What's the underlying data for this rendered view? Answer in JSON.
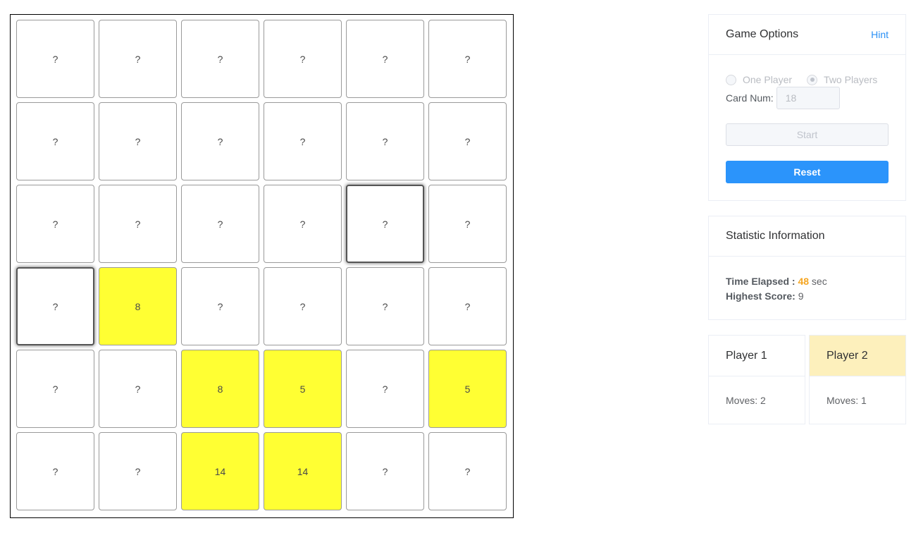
{
  "board": {
    "columns": 6,
    "rows": 6,
    "cards": [
      {
        "label": "?",
        "state": "hidden"
      },
      {
        "label": "?",
        "state": "hidden"
      },
      {
        "label": "?",
        "state": "hidden"
      },
      {
        "label": "?",
        "state": "hidden"
      },
      {
        "label": "?",
        "state": "hidden"
      },
      {
        "label": "?",
        "state": "hidden"
      },
      {
        "label": "?",
        "state": "hidden"
      },
      {
        "label": "?",
        "state": "hidden"
      },
      {
        "label": "?",
        "state": "hidden"
      },
      {
        "label": "?",
        "state": "hidden"
      },
      {
        "label": "?",
        "state": "hidden"
      },
      {
        "label": "?",
        "state": "hidden"
      },
      {
        "label": "?",
        "state": "hidden"
      },
      {
        "label": "?",
        "state": "hidden"
      },
      {
        "label": "?",
        "state": "hidden"
      },
      {
        "label": "?",
        "state": "hidden"
      },
      {
        "label": "?",
        "state": "selected"
      },
      {
        "label": "?",
        "state": "hidden"
      },
      {
        "label": "?",
        "state": "selected"
      },
      {
        "label": "8",
        "state": "matched"
      },
      {
        "label": "?",
        "state": "hidden"
      },
      {
        "label": "?",
        "state": "hidden"
      },
      {
        "label": "?",
        "state": "hidden"
      },
      {
        "label": "?",
        "state": "hidden"
      },
      {
        "label": "?",
        "state": "hidden"
      },
      {
        "label": "?",
        "state": "hidden"
      },
      {
        "label": "8",
        "state": "matched"
      },
      {
        "label": "5",
        "state": "matched"
      },
      {
        "label": "?",
        "state": "hidden"
      },
      {
        "label": "5",
        "state": "matched"
      },
      {
        "label": "?",
        "state": "hidden"
      },
      {
        "label": "?",
        "state": "hidden"
      },
      {
        "label": "14",
        "state": "matched"
      },
      {
        "label": "14",
        "state": "matched"
      },
      {
        "label": "?",
        "state": "hidden"
      },
      {
        "label": "?",
        "state": "hidden"
      }
    ]
  },
  "options": {
    "title": "Game Options",
    "hint_label": "Hint",
    "one_player_label": "One Player",
    "two_players_label": "Two Players",
    "selected_mode": "Two Players",
    "card_num_label": "Card Num:",
    "card_num_value": "18",
    "start_label": "Start",
    "reset_label": "Reset"
  },
  "stats": {
    "title": "Statistic Information",
    "time_label": "Time Elapsed :",
    "time_value": "48",
    "time_unit": "sec",
    "highest_label": "Highest Score:",
    "highest_value": "9"
  },
  "players": [
    {
      "name": "Player 1",
      "moves_label": "Moves: 2",
      "active": false
    },
    {
      "name": "Player 2",
      "moves_label": "Moves: 1",
      "active": true
    }
  ],
  "colors": {
    "matched": "#ffff33",
    "accent": "#2b94fb",
    "active_player": "#fdf0bc",
    "time_highlight": "#f5a623"
  }
}
